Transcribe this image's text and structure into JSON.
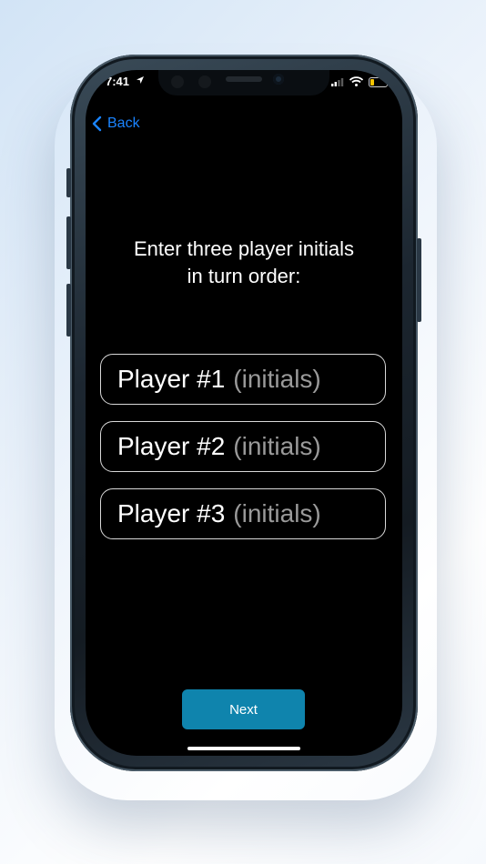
{
  "status_bar": {
    "time": "7:41"
  },
  "nav": {
    "back_label": "Back"
  },
  "prompt": {
    "text": "Enter three player initials\nin turn order:"
  },
  "players": [
    {
      "label": "Player #1",
      "placeholder": "(initials)"
    },
    {
      "label": "Player #2",
      "placeholder": "(initials)"
    },
    {
      "label": "Player #3",
      "placeholder": "(initials)"
    }
  ],
  "next_button": {
    "label": "Next"
  },
  "colors": {
    "accent": "#0f84ad",
    "back_link": "#1a84ff",
    "screen_bg": "#000000",
    "battery_low": "#f5c400"
  },
  "icons": [
    "location-arrow-icon",
    "signal-icon",
    "wifi-icon",
    "battery-icon",
    "chevron-left-icon"
  ]
}
